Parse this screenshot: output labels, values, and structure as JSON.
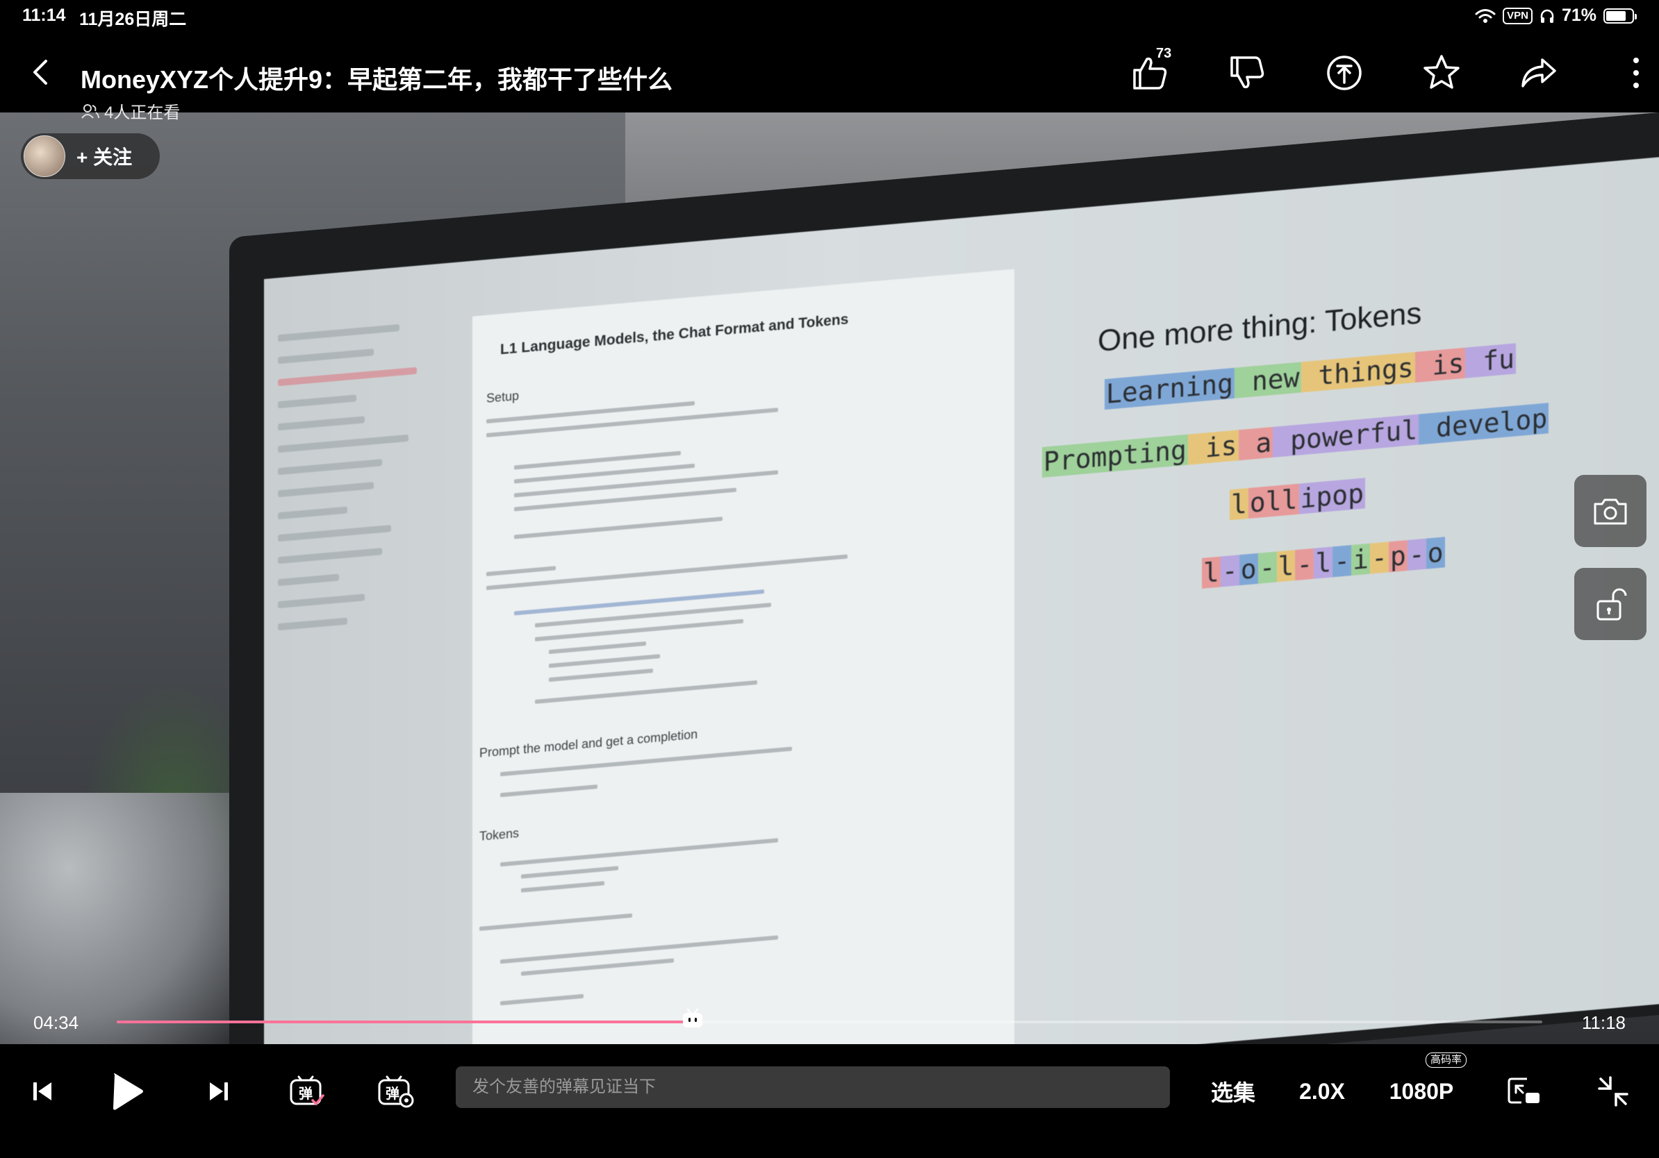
{
  "status": {
    "time": "11:14",
    "date": "11月26日周二",
    "vpn": "VPN",
    "battery": "71%"
  },
  "header": {
    "title": "MoneyXYZ个人提升9：早起第二年，我都干了些什么",
    "like_count": "73"
  },
  "video": {
    "viewers": "4人正在看",
    "follow_label": "+ 关注",
    "notebook": {
      "heading": "L1 Language Models, the Chat Format and Tokens",
      "setup": "Setup",
      "prompt_section": "Prompt the model and get a completion",
      "tokens_section": "Tokens"
    },
    "slide": {
      "title": "One more thing: Tokens",
      "row1": [
        "Learning",
        " new",
        " things",
        " is",
        " fu"
      ],
      "row2": [
        "Prompting",
        " is",
        " a",
        " powerful",
        " develop"
      ],
      "row3": [
        "l",
        "oll",
        "ipop"
      ],
      "row4": [
        "l",
        "-",
        "o",
        "-",
        "l",
        "-",
        "l",
        "-",
        "i",
        "-",
        "p",
        "-",
        "o"
      ]
    },
    "token_colors": [
      "#7fa7d6",
      "#9fd19a",
      "#e6c57a",
      "#e79a9a",
      "#b7a6e0"
    ]
  },
  "player": {
    "current_time": "04:34",
    "total_time": "11:18",
    "progress": 0.404,
    "danmaku_placeholder": "发个友善的弹幕见证当下",
    "episodes": "选集",
    "speed": "2.0X",
    "quality": "1080P",
    "quality_badge": "高码率"
  },
  "icons": {
    "back": "chevron-left-icon",
    "like": "thumbs-up-icon",
    "dislike": "thumbs-down-icon",
    "coin": "coin-icon",
    "favorite": "star-icon",
    "share": "share-icon",
    "more": "more-vertical-icon",
    "screenshot": "camera-icon",
    "lock": "unlock-icon"
  }
}
